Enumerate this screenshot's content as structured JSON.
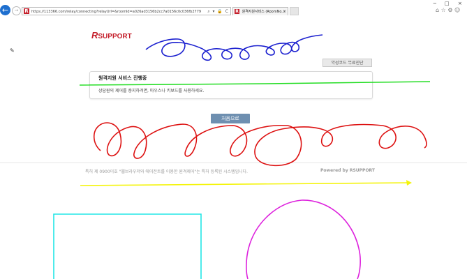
{
  "browser": {
    "url": "https://113366.com/relay/connecting?relayUrl=&roomId=a026ad3156b2cc7a0156c0c036fb2779",
    "address_actions": "⌕ ▾ 🔒 C",
    "tab_title": "원격지원서비스 (RoomNo...",
    "tab_close": "×",
    "favicon_letter": "R",
    "window_controls": {
      "minimize": "−",
      "maximize": "□",
      "close": "×"
    },
    "toolbar_icons": "⌂ ☆ ⚙ ☺"
  },
  "page": {
    "logo": {
      "mark": "R",
      "text": "SUPPORT"
    },
    "malware_check_label": "악성코드 무료진단",
    "notice": {
      "title": "원격지원 서비스 진행중",
      "message": "상담원의 제어를 중지하려면, 마우스나 키보드를 사용하세요."
    },
    "home_button_label": "처음으로",
    "footer": {
      "left": "특허 제 0900이호 \"웹브라우저와 에이전트를 이용한 원격제어\"는 특허 등록된 시스템입니다.",
      "right": "Powered by RSUPPORT"
    },
    "pen_tool_icon": "✎"
  },
  "annotation_colors": {
    "blue": "#1a1fcf",
    "green": "#22dd22",
    "red": "#dd1111",
    "yellow": "#f4f40a",
    "cyan": "#22e6e6",
    "magenta": "#dd22dd",
    "brand": "#c41e2a",
    "button": "#6e8fb0"
  }
}
